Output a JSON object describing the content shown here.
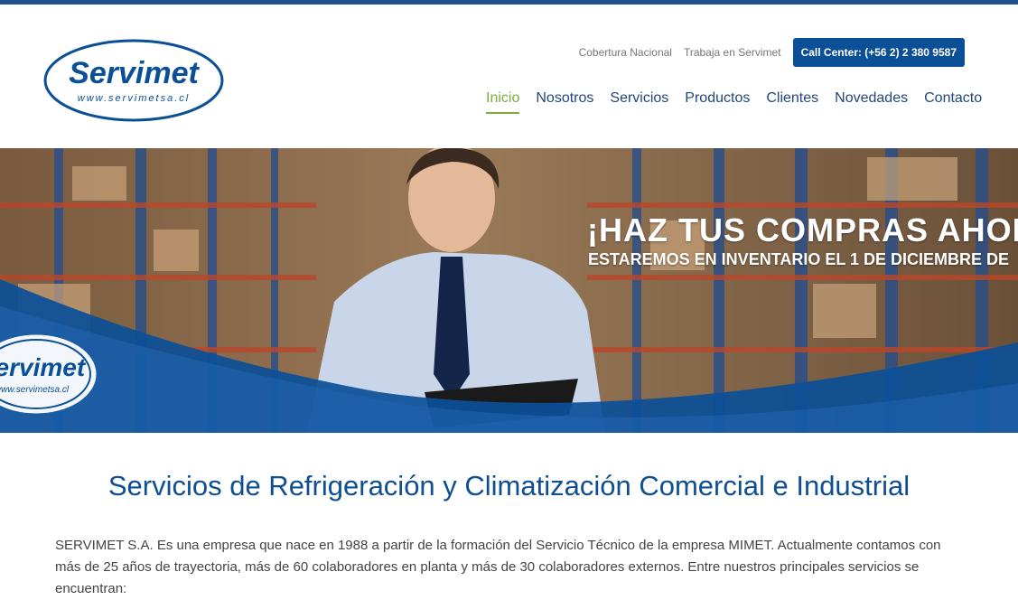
{
  "brand": {
    "logo_name": "Servimet",
    "logo_url": "www.servimetsa.cl",
    "primary_color": "#0b4f97",
    "accent_color": "#7cad3e"
  },
  "utility": {
    "coverage_label": "Cobertura Nacional",
    "jobs_label": "Trabaja en Servimet",
    "call_center_label": "Call Center: (+56 2) 2 380 9587"
  },
  "nav": {
    "items": [
      {
        "label": "Inicio",
        "active": true
      },
      {
        "label": "Nosotros"
      },
      {
        "label": "Servicios"
      },
      {
        "label": "Productos"
      },
      {
        "label": "Clientes"
      },
      {
        "label": "Novedades"
      },
      {
        "label": "Contacto"
      }
    ]
  },
  "hero": {
    "headline": "¡HAZ TUS COMPRAS AHORA",
    "subline": "ESTAREMOS EN INVENTARIO EL 1 DE DICIEMBRE DE",
    "badge_logo": "Servimet",
    "badge_url": "www.servimetsa.cl"
  },
  "main": {
    "title": "Servicios de Refrigeración y Climatización Comercial e Industrial",
    "intro": "SERVIMET S.A. Es una empresa que nace en 1988 a partir de la formación del Servicio Técnico de la empresa MIMET. Actualmente contamos con más de 25 años de trayectoria, más de 60 colaboradores en planta y más de 30 colaboradores externos. Entre nuestros principales servicios se encuentran:"
  }
}
